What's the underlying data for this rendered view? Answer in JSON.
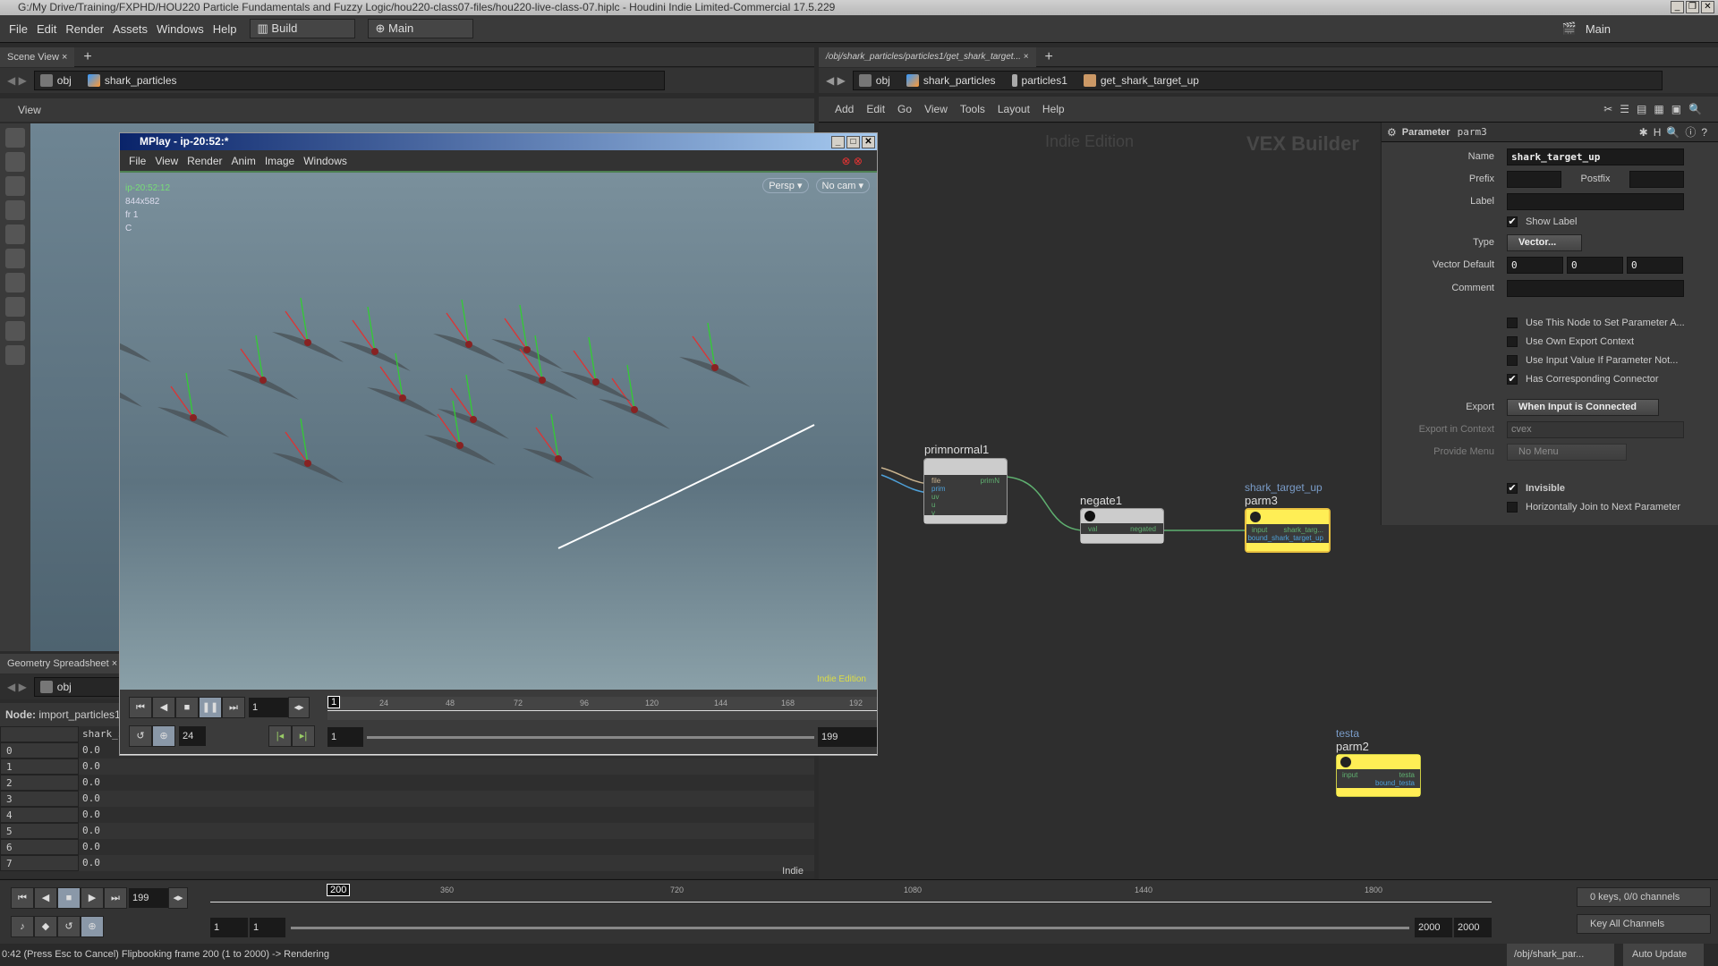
{
  "window": {
    "title": "G:/My Drive/Training/FXPHD/HOU220 Particle Fundamentals and Fuzzy Logic/hou220-class07-files/hou220-live-class-07.hiplc - Houdini Indie Limited-Commercial 17.5.229"
  },
  "menubar": {
    "items": [
      "File",
      "Edit",
      "Render",
      "Assets",
      "Windows",
      "Help"
    ],
    "desktop": "Build",
    "context": "Main",
    "right_desktop": "Main"
  },
  "scene_view": {
    "tab": "Scene View",
    "path": [
      "obj",
      "shark_particles"
    ],
    "toolbar_label": "View"
  },
  "spreadsheet": {
    "tab": "Geometry Spreadsheet",
    "path": [
      "obj"
    ],
    "node_label": "Node:",
    "node_value": "import_particles1",
    "column": "shark_si",
    "rows": [
      [
        "0",
        "0.0"
      ],
      [
        "1",
        "0.0"
      ],
      [
        "2",
        "0.0"
      ],
      [
        "3",
        "0.0"
      ],
      [
        "4",
        "0.0"
      ],
      [
        "5",
        "0.0"
      ],
      [
        "6",
        "0.0"
      ],
      [
        "7",
        "0.0"
      ]
    ],
    "footer": "Indie"
  },
  "mplay": {
    "title": "MPlay - ip-20:52:*",
    "menu": [
      "File",
      "View",
      "Render",
      "Anim",
      "Image",
      "Windows"
    ],
    "info": {
      "name": "ip-20:52:12",
      "res": "844x582",
      "frame": "fr 1",
      "channel": "C"
    },
    "persp": "Persp",
    "cam": "No cam",
    "watermark": "Indie Edition",
    "current_frame": "1",
    "fps": "24",
    "range_start": "1",
    "range_end": "199",
    "ticks": [
      "24",
      "48",
      "72",
      "96",
      "120",
      "144",
      "168",
      "192"
    ],
    "frame_marker": "1"
  },
  "network": {
    "tab": "/obj/shark_particles/particles1/get_shark_target...",
    "path": [
      "obj",
      "shark_particles",
      "particles1",
      "get_shark_target_up"
    ],
    "menu": [
      "Add",
      "Edit",
      "Go",
      "View",
      "Tools",
      "Layout",
      "Help"
    ],
    "edition": "Indie Edition",
    "context": "VEX Builder",
    "nodes": {
      "primnormal1": {
        "name": "primnormal1",
        "inputs": [
          "file",
          "prim",
          "uv",
          "u",
          "v"
        ],
        "output": "primN"
      },
      "negate1": {
        "name": "negate1",
        "input": "val",
        "output": "negated"
      },
      "parm3": {
        "name": "parm3",
        "label": "shark_target_up",
        "input": "input",
        "outputs": [
          "shark_targ...",
          "bound_shark_target_up"
        ]
      },
      "parm2": {
        "name": "parm2",
        "label": "testa",
        "input": "input",
        "outputs": [
          "testa",
          "bound_testa"
        ]
      }
    }
  },
  "parameters": {
    "header": "Parameter",
    "node": "parm3",
    "name_label": "Name",
    "name_value": "shark_target_up",
    "prefix_label": "Prefix",
    "postfix_label": "Postfix",
    "label_label": "Label",
    "show_label": "Show Label",
    "type_label": "Type",
    "type_value": "Vector...",
    "vector_default_label": "Vector Default",
    "vector_default": [
      "0",
      "0",
      "0"
    ],
    "comment_label": "Comment",
    "checks": [
      {
        "label": "Use This Node to Set Parameter A...",
        "checked": false
      },
      {
        "label": "Use Own Export Context",
        "checked": false
      },
      {
        "label": "Use Input Value If Parameter Not...",
        "checked": false
      },
      {
        "label": "Has Corresponding Connector",
        "checked": true
      }
    ],
    "export_label": "Export",
    "export_value": "When Input is Connected",
    "export_context_label": "Export in Context",
    "export_context_value": "cvex",
    "provide_menu_label": "Provide Menu",
    "provide_menu_value": "No Menu",
    "invisible": "Invisible",
    "hjoin": "Horizontally Join to Next Parameter"
  },
  "timeline": {
    "current": "199",
    "marker": "200",
    "ticks": [
      "360",
      "720",
      "1080",
      "1440",
      "1800"
    ],
    "start": "1",
    "start2": "1",
    "end": "2000",
    "end2": "2000",
    "keys": "0 keys, 0/0 channels",
    "key_all": "Key All Channels"
  },
  "status": {
    "message": "0:42 (Press Esc to Cancel) Flipbooking frame 200 (1 to 2000) -> Rendering",
    "path": "/obj/shark_par...",
    "update": "Auto Update"
  }
}
